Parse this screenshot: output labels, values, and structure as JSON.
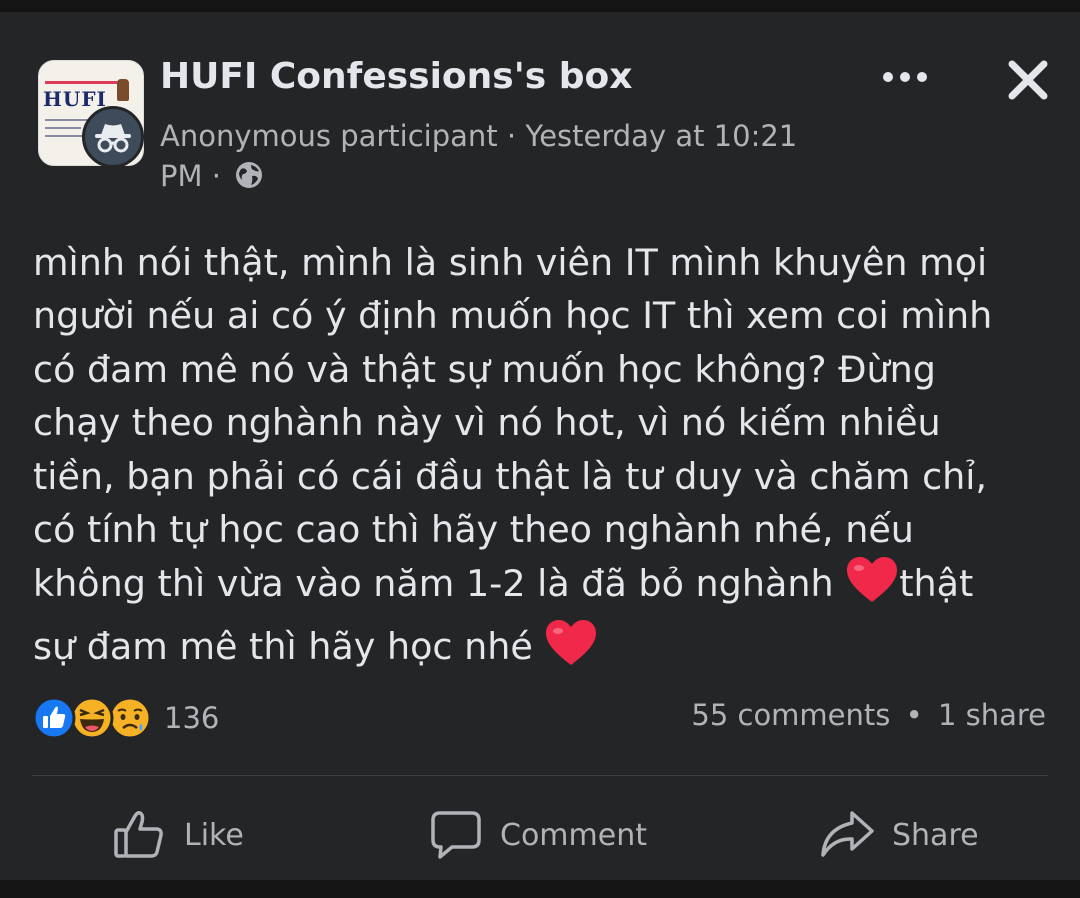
{
  "header": {
    "page_name": "HUFI Confessions's box",
    "author": "Anonymous participant",
    "separator": " · ",
    "time_line1": "Yesterday at 10:21",
    "time_line2": "PM ·",
    "thumb_logo": "HUFI",
    "audience_icon": "globe-icon",
    "more_icon": "more-options-icon",
    "close_icon": "close-icon"
  },
  "post": {
    "text_part1": "mình nói thật, mình là sinh viên IT mình khuyên mọi\nngười nếu ai có ý định muốn học IT thì xem coi mình\ncó đam mê nó và thật sự muốn học không? Đừng\nchạy theo nghành này vì nó hot, vì nó kiếm nhiều\ntiền, bạn phải có cái đầu thật là tư duy và chăm chỉ,\ncó tính tự học cao thì hãy theo nghành nhé, nếu\nkhông thì vừa vào năm 1-2 là đã bỏ nghành ",
    "text_part2": "thật\nsự đam mê thì hãy học nhé ",
    "emoji": "heart-emoji"
  },
  "reactions": {
    "icons": [
      "like-icon",
      "haha-icon",
      "sad-icon"
    ],
    "count": "136"
  },
  "stats": {
    "comments": "55 comments",
    "dot": "•",
    "shares": "1 share"
  },
  "actions": {
    "like": "Like",
    "comment": "Comment",
    "share": "Share"
  },
  "colors": {
    "background": "#242526",
    "text": "#e4e6eb",
    "secondary": "#b0b3b8",
    "like_blue": "#1877f2",
    "heart_red": "#f02849"
  }
}
